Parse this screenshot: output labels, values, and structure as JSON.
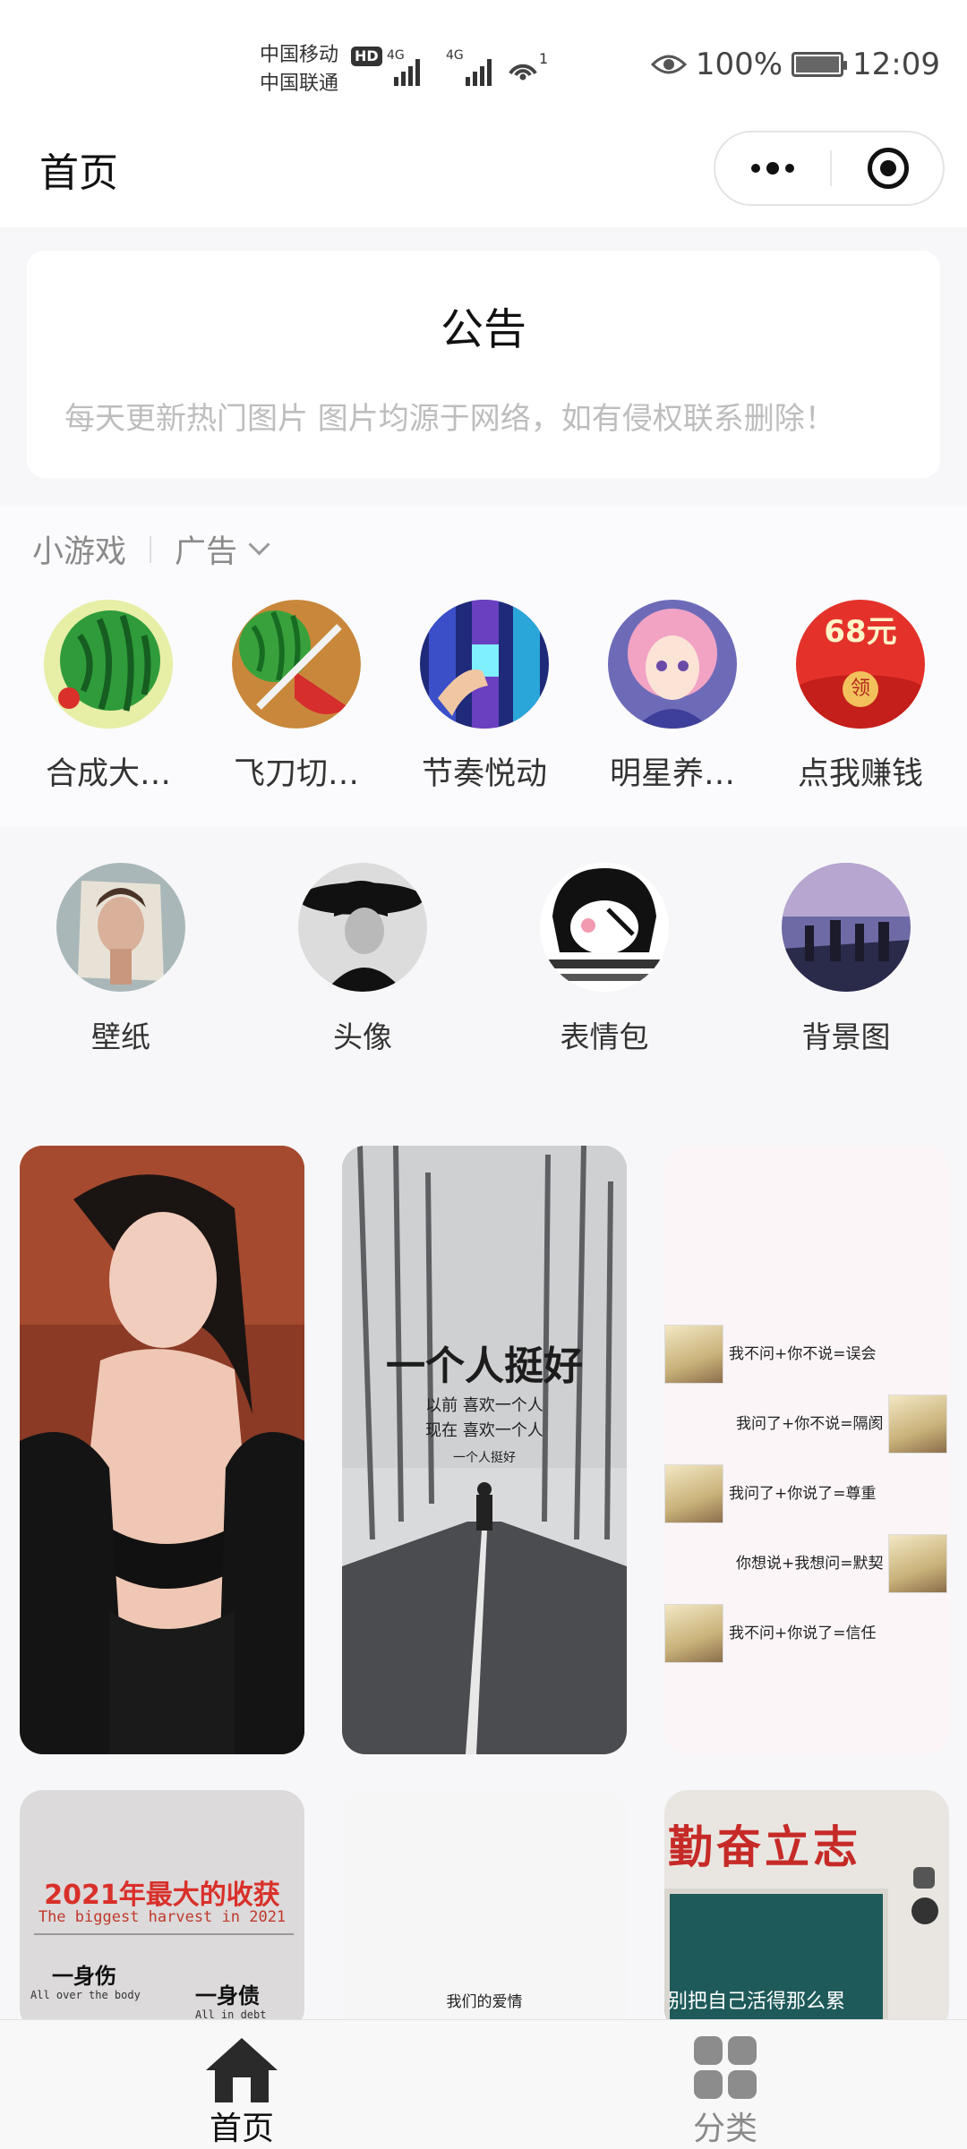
{
  "status_bar": {
    "carrier1": "中国移动",
    "carrier2": "中国联通",
    "hd_badge": "HD",
    "signal_label": "4G",
    "signal2_label": "4G",
    "wifi_sub": "1",
    "battery_percent": "100%",
    "time": "12:09"
  },
  "header": {
    "title": "首页"
  },
  "notice": {
    "title": "公告",
    "text": "每天更新热门图片 图片均源于网络，如有侵权联系删除！"
  },
  "games_section": {
    "label": "小游戏",
    "ad_label": "广告",
    "items": [
      {
        "name": "合成大…",
        "icon": "watermelon-icon"
      },
      {
        "name": "飞刀切…",
        "icon": "sliced-watermelon-icon"
      },
      {
        "name": "节奏悦动",
        "icon": "piano-tiles-icon"
      },
      {
        "name": "明星养…",
        "icon": "anime-girl-icon"
      },
      {
        "name": "点我赚钱",
        "icon": "red-envelope-icon",
        "badge": "68元",
        "badge_sub": "领"
      }
    ]
  },
  "categories": [
    {
      "name": "壁纸"
    },
    {
      "name": "头像"
    },
    {
      "name": "表情包"
    },
    {
      "name": "背景图"
    }
  ],
  "feed": {
    "card2": {
      "headline": "一个人挺好",
      "line1": "以前 喜欢一个人",
      "line2": "现在 喜欢一个人",
      "line3": "一个人挺好"
    },
    "card3": {
      "rows": [
        "我不问+你不说=误会",
        "我问了+你不说=隔阂",
        "我问了+你说了=尊重",
        "你想说+我想问=默契",
        "我不问+你说了=信任"
      ]
    },
    "card4": {
      "title": "2021年最大的收获",
      "subtitle": "The biggest harvest in 2021",
      "item1": "一身伤",
      "item1_en": "All over the body",
      "item2": "一身债",
      "item2_en": "All in debt"
    },
    "card5": {
      "text": "我们的爱情"
    },
    "card6": {
      "title": "勤奋立志",
      "caption": "别把自己活得那么累"
    }
  },
  "tabbar": {
    "home": "首页",
    "category": "分类"
  },
  "colors": {
    "accent_red": "#d9302a",
    "text_dark": "#222222",
    "text_grey": "#8a8a8a"
  }
}
